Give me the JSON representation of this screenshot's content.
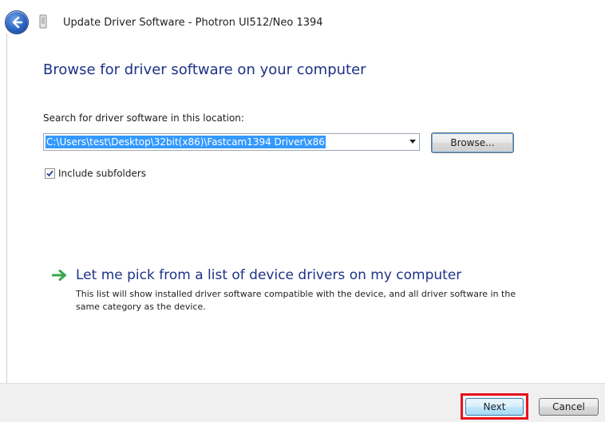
{
  "window": {
    "title": "Update Driver Software - Photron UI512/Neo 1394"
  },
  "page": {
    "heading": "Browse for driver software on your computer",
    "search_label": "Search for driver software in this location:",
    "path_value": "C:\\Users\\test\\Desktop\\32bit(x86)\\Fastcam1394 Driver\\x86",
    "browse_label": "Browse...",
    "include_subfolders": {
      "label": "Include subfolders",
      "checked": true
    },
    "pick_option": {
      "title": "Let me pick from a list of device drivers on my computer",
      "description": "This list will show installed driver software compatible with the device, and all driver software in the same category as the device."
    }
  },
  "footer": {
    "next_label": "Next",
    "cancel_label": "Cancel"
  },
  "colors": {
    "heading": "#1e3287",
    "selection": "#3399ff",
    "highlight_border": "#e8101a",
    "arrow": "#3aa74a"
  },
  "icons": {
    "back": "back-arrow-icon",
    "device": "device-icon",
    "pick_arrow": "green-arrow-icon"
  }
}
